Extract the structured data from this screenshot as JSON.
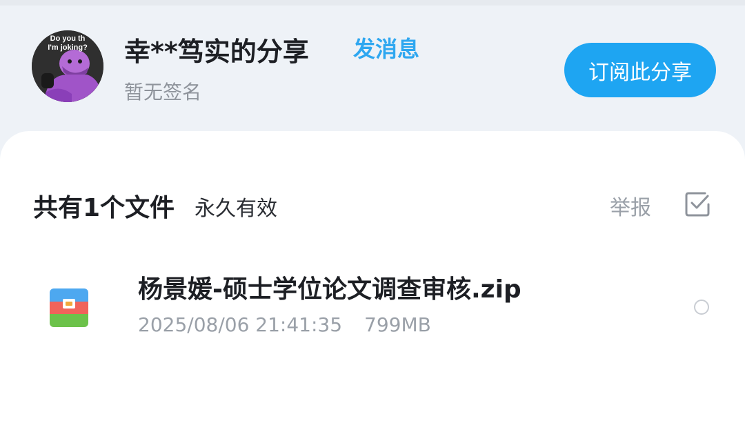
{
  "header": {
    "avatar_text_line1": "Do you th",
    "avatar_text_line2": "I'm joking?",
    "owner_name": "幸**笃实的分享",
    "message_link": "发消息",
    "signature": "暂无签名",
    "subscribe_button": "订阅此分享"
  },
  "summary": {
    "file_count_label": "共有1个文件",
    "validity": "永久有效",
    "report_link": "举报"
  },
  "files": [
    {
      "name": "杨景媛-硕士学位论文调查审核.zip",
      "date": "2025/08/06 21:41:35",
      "size": "799MB",
      "icon": "zip-archive-icon"
    }
  ],
  "colors": {
    "accent": "#1ea5f2",
    "link": "#2ea7f0",
    "background": "#eef2f7",
    "muted_text": "#9aa0a8"
  }
}
